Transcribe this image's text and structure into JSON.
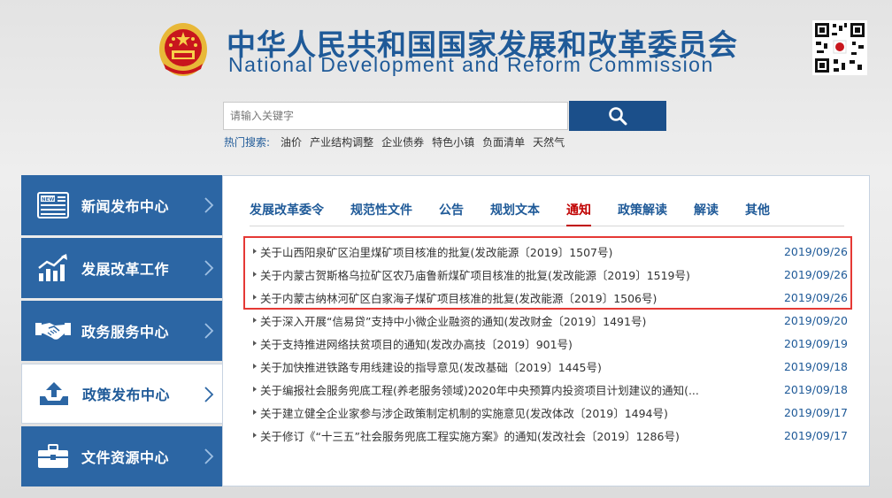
{
  "header": {
    "title_cn": "中华人民共和国国家发展和改革委员会",
    "title_en": "National Development and Reform Commission"
  },
  "search": {
    "placeholder": "请输入关键字",
    "hot_label": "热门搜索:",
    "hot_terms": [
      "油价",
      "产业结构调整",
      "企业债券",
      "特色小镇",
      "负面清单",
      "天然气"
    ]
  },
  "sidebar": {
    "items": [
      {
        "label": "新闻发布中心",
        "icon": "news-icon"
      },
      {
        "label": "发展改革工作",
        "icon": "growth-chart-icon"
      },
      {
        "label": "政务服务中心",
        "icon": "handshake-icon"
      },
      {
        "label": "政策发布中心",
        "icon": "upload-tray-icon"
      },
      {
        "label": "文件资源中心",
        "icon": "briefcase-icon"
      }
    ],
    "active_index": 3
  },
  "tabs": [
    "发展改革委令",
    "规范性文件",
    "公告",
    "规划文本",
    "通知",
    "政策解读",
    "解读",
    "其他"
  ],
  "active_tab": "通知",
  "notices": [
    {
      "title": "关于山西阳泉矿区泊里煤矿项目核准的批复(发改能源〔2019〕1507号)",
      "date": "2019/09/26"
    },
    {
      "title": "关于内蒙古贺斯格乌拉矿区农乃庙鲁新煤矿项目核准的批复(发改能源〔2019〕1519号)",
      "date": "2019/09/26"
    },
    {
      "title": "关于内蒙古纳林河矿区白家海子煤矿项目核准的批复(发改能源〔2019〕1506号)",
      "date": "2019/09/26"
    },
    {
      "title": "关于深入开展“信易贷”支持中小微企业融资的通知(发改财金〔2019〕1491号)",
      "date": "2019/09/20"
    },
    {
      "title": "关于支持推进网络扶贫项目的通知(发改办高技〔2019〕901号)",
      "date": "2019/09/19"
    },
    {
      "title": "关于加快推进铁路专用线建设的指导意见(发改基础〔2019〕1445号)",
      "date": "2019/09/18"
    },
    {
      "title": "关于编报社会服务兜底工程(养老服务领域)2020年中央预算内投资项目计划建议的通知(...",
      "date": "2019/09/18"
    },
    {
      "title": "关于建立健全企业家参与涉企政策制定机制的实施意见(发改体改〔2019〕1494号)",
      "date": "2019/09/17"
    },
    {
      "title": "关于修订《“十三五”社会服务兜底工程实施方案》的通知(发改社会〔2019〕1286号)",
      "date": "2019/09/17"
    }
  ],
  "colors": {
    "brand_blue": "#1f5a98",
    "sidebar_blue": "#2c66a4",
    "active_red": "#c00000",
    "highlight_red": "#e53935"
  }
}
